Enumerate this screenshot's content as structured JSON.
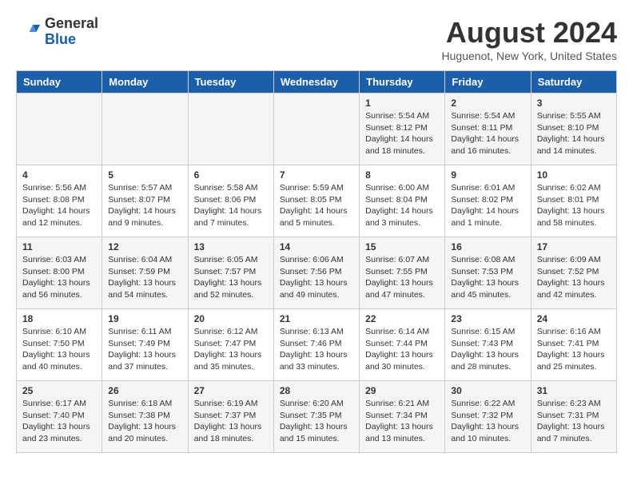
{
  "header": {
    "logo_general": "General",
    "logo_blue": "Blue",
    "month_title": "August 2024",
    "location": "Huguenot, New York, United States"
  },
  "weekdays": [
    "Sunday",
    "Monday",
    "Tuesday",
    "Wednesday",
    "Thursday",
    "Friday",
    "Saturday"
  ],
  "weeks": [
    [
      {
        "day": "",
        "info": ""
      },
      {
        "day": "",
        "info": ""
      },
      {
        "day": "",
        "info": ""
      },
      {
        "day": "",
        "info": ""
      },
      {
        "day": "1",
        "info": "Sunrise: 5:54 AM\nSunset: 8:12 PM\nDaylight: 14 hours\nand 18 minutes."
      },
      {
        "day": "2",
        "info": "Sunrise: 5:54 AM\nSunset: 8:11 PM\nDaylight: 14 hours\nand 16 minutes."
      },
      {
        "day": "3",
        "info": "Sunrise: 5:55 AM\nSunset: 8:10 PM\nDaylight: 14 hours\nand 14 minutes."
      }
    ],
    [
      {
        "day": "4",
        "info": "Sunrise: 5:56 AM\nSunset: 8:08 PM\nDaylight: 14 hours\nand 12 minutes."
      },
      {
        "day": "5",
        "info": "Sunrise: 5:57 AM\nSunset: 8:07 PM\nDaylight: 14 hours\nand 9 minutes."
      },
      {
        "day": "6",
        "info": "Sunrise: 5:58 AM\nSunset: 8:06 PM\nDaylight: 14 hours\nand 7 minutes."
      },
      {
        "day": "7",
        "info": "Sunrise: 5:59 AM\nSunset: 8:05 PM\nDaylight: 14 hours\nand 5 minutes."
      },
      {
        "day": "8",
        "info": "Sunrise: 6:00 AM\nSunset: 8:04 PM\nDaylight: 14 hours\nand 3 minutes."
      },
      {
        "day": "9",
        "info": "Sunrise: 6:01 AM\nSunset: 8:02 PM\nDaylight: 14 hours\nand 1 minute."
      },
      {
        "day": "10",
        "info": "Sunrise: 6:02 AM\nSunset: 8:01 PM\nDaylight: 13 hours\nand 58 minutes."
      }
    ],
    [
      {
        "day": "11",
        "info": "Sunrise: 6:03 AM\nSunset: 8:00 PM\nDaylight: 13 hours\nand 56 minutes."
      },
      {
        "day": "12",
        "info": "Sunrise: 6:04 AM\nSunset: 7:59 PM\nDaylight: 13 hours\nand 54 minutes."
      },
      {
        "day": "13",
        "info": "Sunrise: 6:05 AM\nSunset: 7:57 PM\nDaylight: 13 hours\nand 52 minutes."
      },
      {
        "day": "14",
        "info": "Sunrise: 6:06 AM\nSunset: 7:56 PM\nDaylight: 13 hours\nand 49 minutes."
      },
      {
        "day": "15",
        "info": "Sunrise: 6:07 AM\nSunset: 7:55 PM\nDaylight: 13 hours\nand 47 minutes."
      },
      {
        "day": "16",
        "info": "Sunrise: 6:08 AM\nSunset: 7:53 PM\nDaylight: 13 hours\nand 45 minutes."
      },
      {
        "day": "17",
        "info": "Sunrise: 6:09 AM\nSunset: 7:52 PM\nDaylight: 13 hours\nand 42 minutes."
      }
    ],
    [
      {
        "day": "18",
        "info": "Sunrise: 6:10 AM\nSunset: 7:50 PM\nDaylight: 13 hours\nand 40 minutes."
      },
      {
        "day": "19",
        "info": "Sunrise: 6:11 AM\nSunset: 7:49 PM\nDaylight: 13 hours\nand 37 minutes."
      },
      {
        "day": "20",
        "info": "Sunrise: 6:12 AM\nSunset: 7:47 PM\nDaylight: 13 hours\nand 35 minutes."
      },
      {
        "day": "21",
        "info": "Sunrise: 6:13 AM\nSunset: 7:46 PM\nDaylight: 13 hours\nand 33 minutes."
      },
      {
        "day": "22",
        "info": "Sunrise: 6:14 AM\nSunset: 7:44 PM\nDaylight: 13 hours\nand 30 minutes."
      },
      {
        "day": "23",
        "info": "Sunrise: 6:15 AM\nSunset: 7:43 PM\nDaylight: 13 hours\nand 28 minutes."
      },
      {
        "day": "24",
        "info": "Sunrise: 6:16 AM\nSunset: 7:41 PM\nDaylight: 13 hours\nand 25 minutes."
      }
    ],
    [
      {
        "day": "25",
        "info": "Sunrise: 6:17 AM\nSunset: 7:40 PM\nDaylight: 13 hours\nand 23 minutes."
      },
      {
        "day": "26",
        "info": "Sunrise: 6:18 AM\nSunset: 7:38 PM\nDaylight: 13 hours\nand 20 minutes."
      },
      {
        "day": "27",
        "info": "Sunrise: 6:19 AM\nSunset: 7:37 PM\nDaylight: 13 hours\nand 18 minutes."
      },
      {
        "day": "28",
        "info": "Sunrise: 6:20 AM\nSunset: 7:35 PM\nDaylight: 13 hours\nand 15 minutes."
      },
      {
        "day": "29",
        "info": "Sunrise: 6:21 AM\nSunset: 7:34 PM\nDaylight: 13 hours\nand 13 minutes."
      },
      {
        "day": "30",
        "info": "Sunrise: 6:22 AM\nSunset: 7:32 PM\nDaylight: 13 hours\nand 10 minutes."
      },
      {
        "day": "31",
        "info": "Sunrise: 6:23 AM\nSunset: 7:31 PM\nDaylight: 13 hours\nand 7 minutes."
      }
    ]
  ]
}
